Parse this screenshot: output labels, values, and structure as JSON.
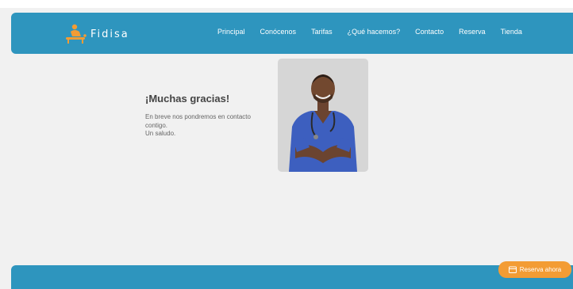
{
  "brand": {
    "name": "Fidisa"
  },
  "nav": {
    "items": [
      "Principal",
      "Conócenos",
      "Tarifas",
      "¿Qué hacemos?",
      "Contacto",
      "Reserva",
      "Tienda"
    ]
  },
  "thanks": {
    "title": "¡Muchas gracias!",
    "line1": "En breve nos pondremos en contacto",
    "line2": "contigo.",
    "line3": "Un saludo."
  },
  "cta": {
    "label": "Reserva ahora"
  },
  "colors": {
    "primary": "#2e95be",
    "accent": "#f39c34",
    "background": "#f1f1f1"
  }
}
